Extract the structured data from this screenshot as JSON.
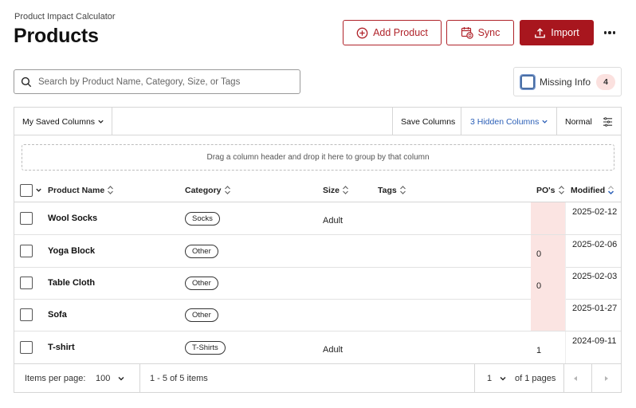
{
  "header": {
    "app_name": "Product Impact Calculator",
    "page_title": "Products"
  },
  "actions": {
    "add_product": "Add Product",
    "sync": "Sync",
    "import": "Import",
    "more_icon": "more-horizontal-icon"
  },
  "search": {
    "placeholder": "Search by Product Name, Category, Size, or Tags",
    "value": ""
  },
  "missing_info": {
    "label": "Missing Info",
    "count": "4",
    "checked": false
  },
  "toolbar": {
    "saved_columns": "My Saved Columns",
    "save_columns": "Save Columns",
    "hidden_columns": "3 Hidden Columns",
    "density": "Normal"
  },
  "group_zone": {
    "text": "Drag a column header and drop it here to group by that column"
  },
  "columns": {
    "name": "Product Name",
    "category": "Category",
    "size": "Size",
    "tags": "Tags",
    "pos": "PO's",
    "modified": "Modified"
  },
  "rows": [
    {
      "name": "Wool Socks",
      "category": "Socks",
      "size": "Adult",
      "tags": "",
      "pos": "",
      "modified": "2025-02-12"
    },
    {
      "name": "Yoga Block",
      "category": "Other",
      "size": "",
      "tags": "",
      "pos": "0",
      "modified": "2025-02-06"
    },
    {
      "name": "Table Cloth",
      "category": "Other",
      "size": "",
      "tags": "",
      "pos": "0",
      "modified": "2025-02-03"
    },
    {
      "name": "Sofa",
      "category": "Other",
      "size": "",
      "tags": "",
      "pos": "",
      "modified": "2025-01-27"
    },
    {
      "name": "T-shirt",
      "category": "T-Shirts",
      "size": "Adult",
      "tags": "",
      "pos": "1",
      "modified": "2024-09-11"
    }
  ],
  "pagination": {
    "items_per_page_label": "Items per page:",
    "items_per_page": "100",
    "range": "1 - 5 of 5 items",
    "page": "1",
    "of_pages": "of 1 pages"
  },
  "colors": {
    "brand": "#a8161e",
    "link": "#2b5fb7",
    "missing_highlight": "#fbe4e2"
  }
}
